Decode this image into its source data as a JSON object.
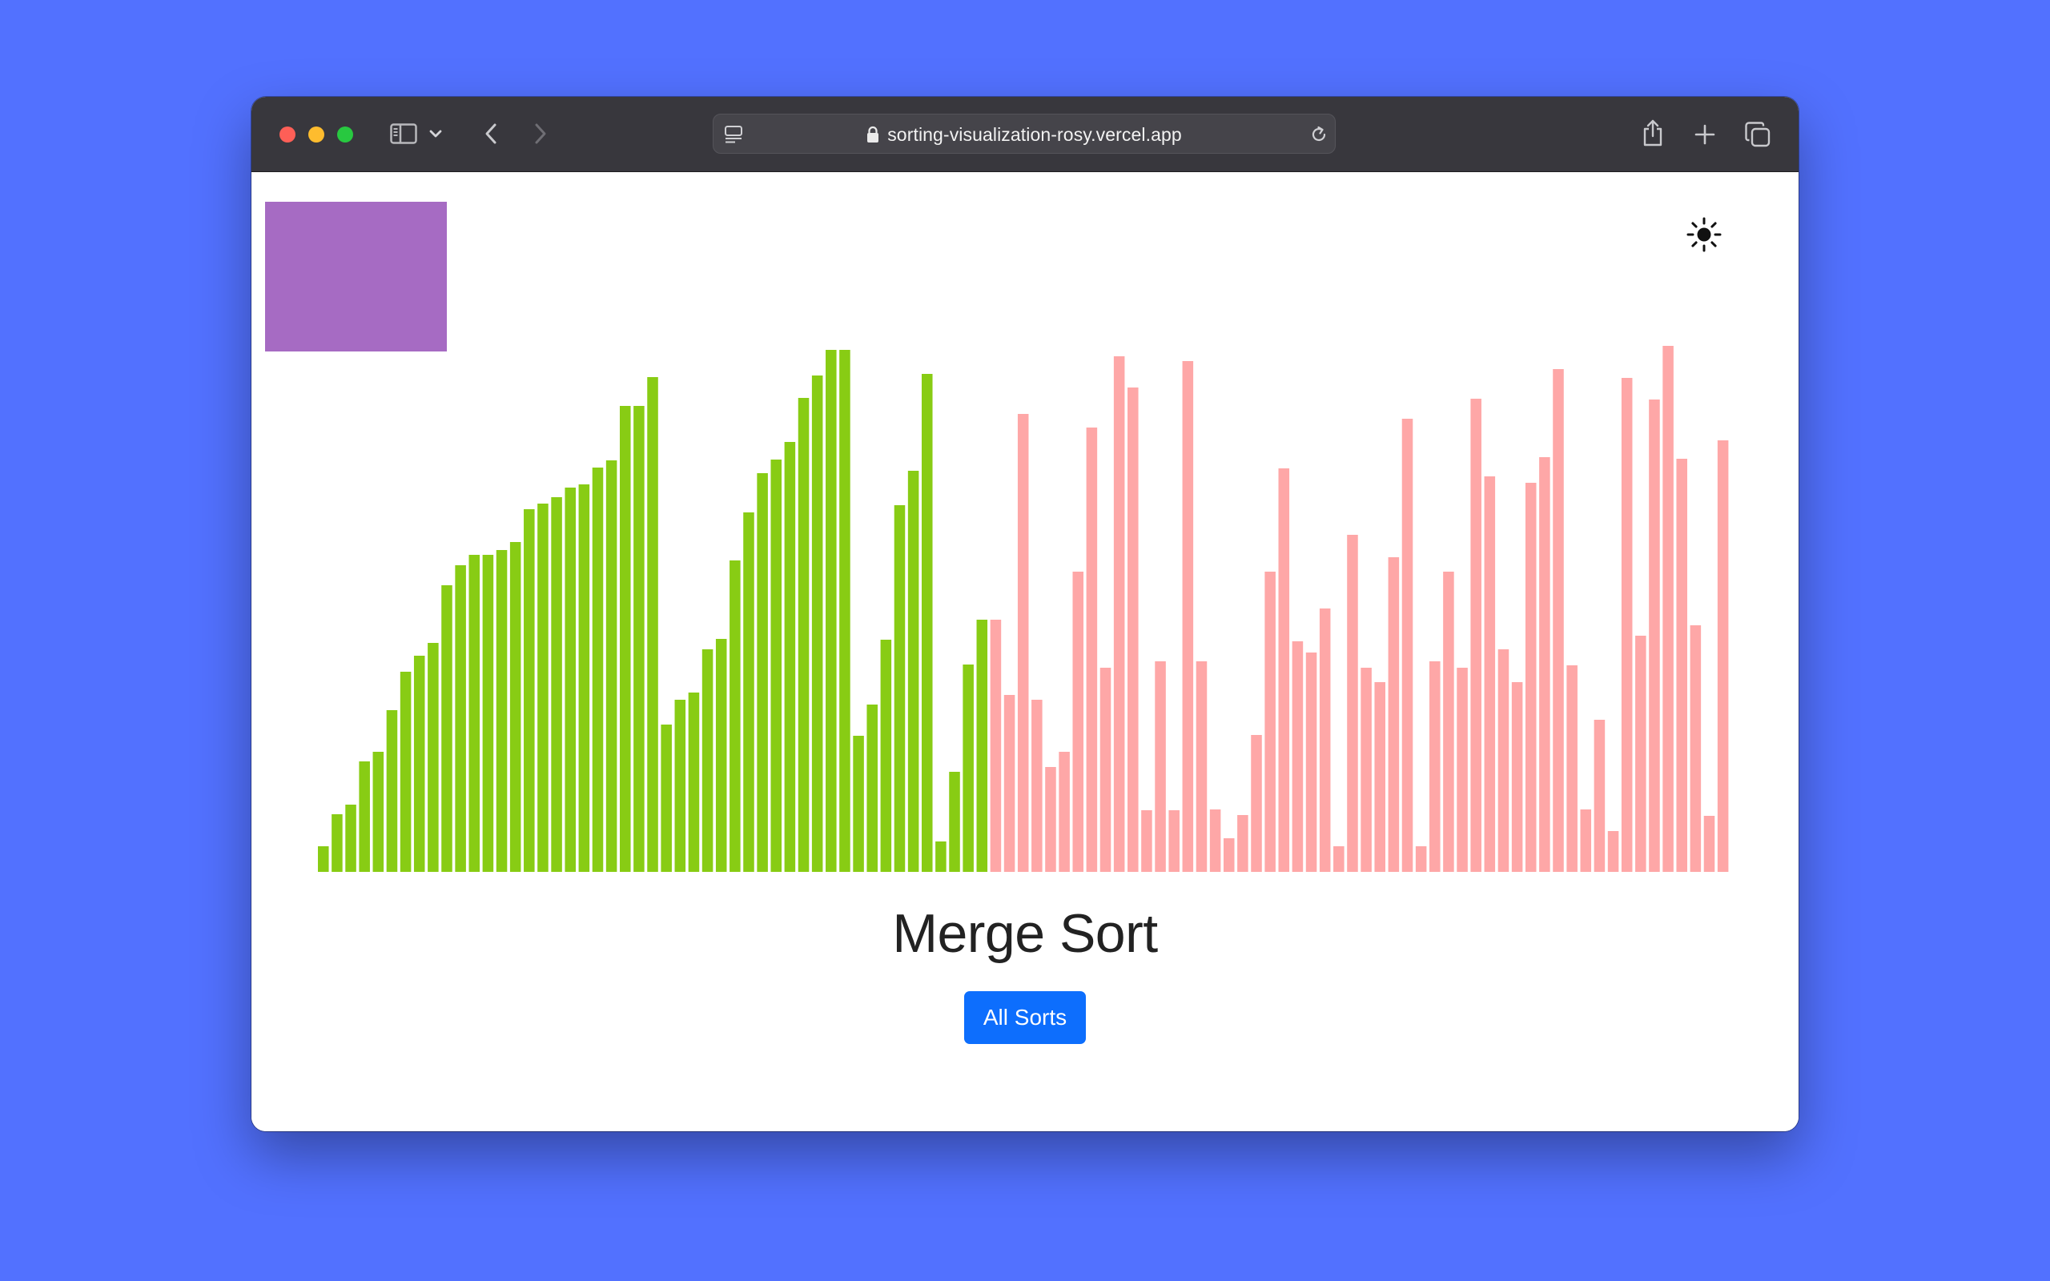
{
  "browser": {
    "url": "sorting-visualization-rosy.vercel.app",
    "icons": [
      "sidebar-icon",
      "chevron-down-icon",
      "back-icon",
      "forward-icon",
      "reader-icon",
      "lock-icon",
      "reload-icon",
      "share-icon",
      "new-tab-icon",
      "tabs-overview-icon"
    ]
  },
  "page": {
    "title": "Merge Sort",
    "button_label": "All Sorts",
    "theme_icon": "sun-icon",
    "colors": {
      "sorted": "#88cc14",
      "unsorted": "#fea7a7",
      "box": "#a66bc3",
      "button": "#0d6efd",
      "background": "#5271ff"
    }
  },
  "chart_data": {
    "type": "bar",
    "sorted_count": 49,
    "values": [
      32,
      72,
      84,
      138,
      150,
      202,
      250,
      270,
      286,
      358,
      383,
      396,
      396,
      402,
      412,
      453,
      460,
      468,
      480,
      484,
      505,
      514,
      582,
      582,
      618,
      184,
      215,
      224,
      278,
      291,
      389,
      449,
      498,
      515,
      537,
      592,
      620,
      652,
      652,
      170,
      209,
      290,
      458,
      501,
      622,
      38,
      125,
      259,
      315,
      315,
      221,
      572,
      215,
      131,
      150,
      375,
      555,
      255,
      644,
      605,
      77,
      263,
      77,
      638,
      263,
      78,
      42,
      71,
      171,
      375,
      504,
      288,
      274,
      329,
      32,
      421,
      255,
      237,
      393,
      566,
      32,
      263,
      375,
      255,
      591,
      494,
      278,
      237,
      486,
      518,
      628,
      258,
      78,
      190,
      51,
      617,
      295,
      590,
      657,
      516,
      308,
      70,
      539
    ]
  }
}
